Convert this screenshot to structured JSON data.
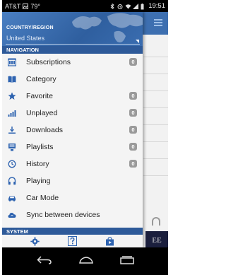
{
  "status_bar": {
    "carrier": "AT&T",
    "temperature": "79°",
    "time": "19:51"
  },
  "drawer": {
    "region": {
      "label": "COUNTRY/REGION",
      "value": "United States"
    },
    "navigation_header": "NAVIGATION",
    "items": [
      {
        "label": "Subscriptions",
        "icon": "subscriptions-icon",
        "badge": "0"
      },
      {
        "label": "Category",
        "icon": "book-icon",
        "badge": null
      },
      {
        "label": "Favorite",
        "icon": "star-icon",
        "badge": "0"
      },
      {
        "label": "Unplayed",
        "icon": "signal-bars-icon",
        "badge": "0"
      },
      {
        "label": "Downloads",
        "icon": "download-icon",
        "badge": "0"
      },
      {
        "label": "Playlists",
        "icon": "playlist-icon",
        "badge": "0"
      },
      {
        "label": "History",
        "icon": "history-icon",
        "badge": "0"
      },
      {
        "label": "Playing",
        "icon": "headphones-icon",
        "badge": null
      },
      {
        "label": "Car Mode",
        "icon": "car-icon",
        "badge": null
      },
      {
        "label": "Sync between devices",
        "icon": "cloud-sync-icon",
        "badge": null
      }
    ],
    "system_header": "SYSTEM",
    "system_buttons": [
      "settings-icon",
      "help-icon",
      "store-icon"
    ]
  },
  "background_app": {
    "thumb_text": "EE"
  },
  "colors": {
    "accent": "#2e63b0",
    "header_blue": "#2e5a99",
    "badge": "#9a9a9a"
  }
}
